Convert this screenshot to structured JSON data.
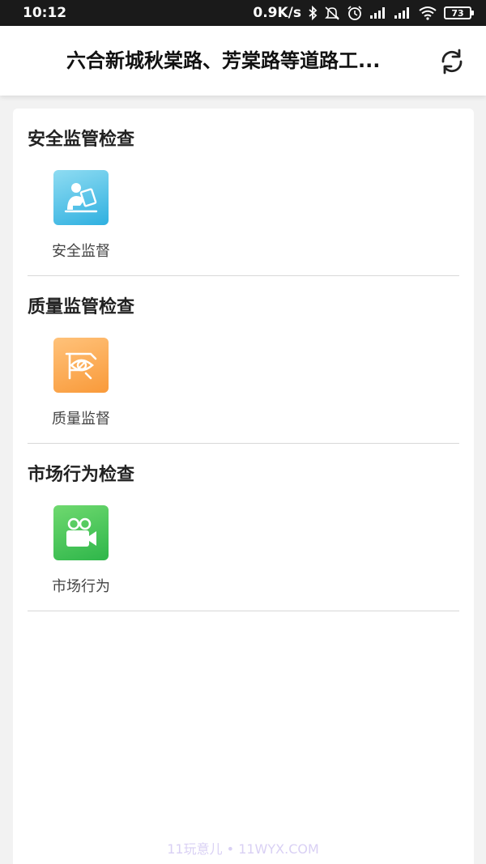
{
  "status_bar": {
    "time": "10:12",
    "network_speed": "0.9K/s",
    "battery": "73",
    "icons": [
      "bluetooth-icon",
      "mute-icon",
      "alarm-icon",
      "signal-icon",
      "signal-icon",
      "wifi-icon",
      "battery-icon"
    ]
  },
  "header": {
    "title": "六合新城秋棠路、芳棠路等道路工...",
    "refresh_icon": "refresh-icon"
  },
  "sections": [
    {
      "title": "安全监管检查",
      "item_label": "安全监督",
      "icon": "person-clipboard-icon",
      "gradient": [
        "#8fdcf2",
        "#2fb0e0"
      ]
    },
    {
      "title": "质量监管检查",
      "item_label": "质量监督",
      "icon": "eye-inspection-icon",
      "gradient": [
        "#ffc27a",
        "#f99a3a"
      ]
    },
    {
      "title": "市场行为检查",
      "item_label": "市场行为",
      "icon": "video-camera-icon",
      "gradient": [
        "#6fd96f",
        "#2eb64a"
      ]
    }
  ],
  "watermark": "11玩意儿 • 11WYX.COM"
}
